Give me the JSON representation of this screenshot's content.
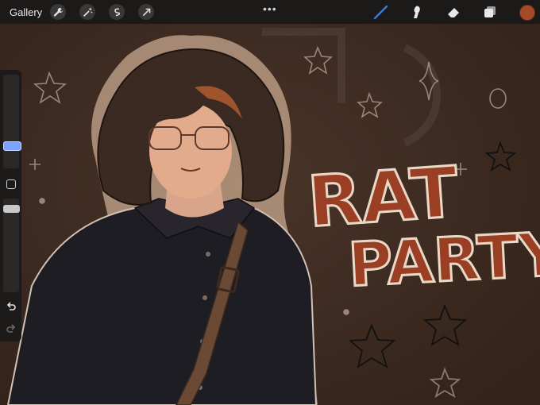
{
  "toolbar": {
    "gallery_label": "Gallery",
    "left_tools": [
      {
        "name": "wrench-icon"
      },
      {
        "name": "magic-wand-icon"
      },
      {
        "name": "selection-icon"
      },
      {
        "name": "transform-arrow-icon"
      }
    ],
    "more_label": "•••",
    "right_tools": [
      {
        "name": "brush-icon",
        "active_color": "#2f7cf6"
      },
      {
        "name": "smudge-icon"
      },
      {
        "name": "eraser-icon"
      },
      {
        "name": "layers-icon"
      }
    ],
    "current_color": "#a84a2a"
  },
  "canvas": {
    "artwork_text_line1": "RAT",
    "artwork_text_line2": "PARTY"
  },
  "sidebar": {
    "brush_size_level": 0.3,
    "opacity_level": 0.95
  },
  "colors": {
    "background_brown": "#3d2a20",
    "toolbar_dark": "#1c1a19",
    "lettering_rust": "#9a3e24",
    "lettering_outline": "#e9d9c7",
    "slider_blue": "#7aa2ff"
  }
}
